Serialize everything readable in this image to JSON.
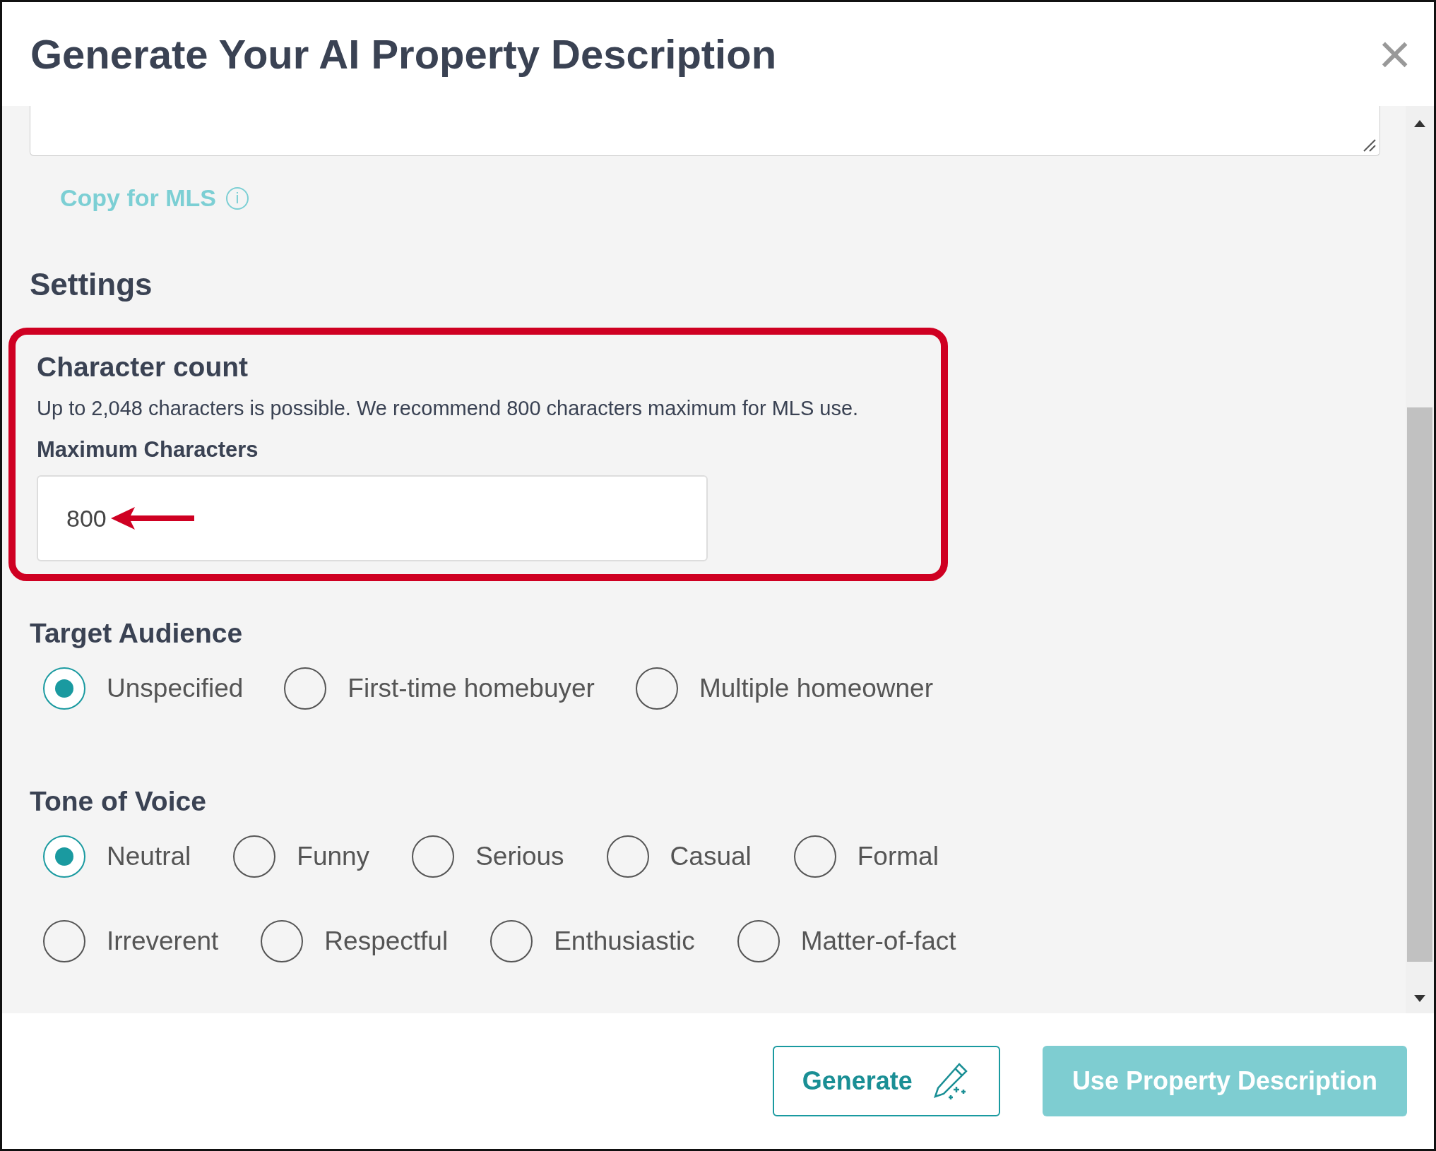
{
  "dialog": {
    "title": "Generate Your AI Property Description",
    "close": "×"
  },
  "copy_link": {
    "label": "Copy for MLS",
    "info": "i"
  },
  "settings": {
    "title": "Settings",
    "character_count": {
      "title": "Character count",
      "highlighted": true,
      "description": "Up to 2,048 characters is possible. We recommend 800 characters maximum for MLS use.",
      "field_label": "Maximum Characters",
      "value": "800"
    },
    "target_audience": {
      "title": "Target Audience",
      "options": [
        {
          "label": "Unspecified",
          "selected": true
        },
        {
          "label": "First-time homebuyer",
          "selected": false
        },
        {
          "label": "Multiple homeowner",
          "selected": false
        }
      ]
    },
    "tone_of_voice": {
      "title": "Tone of Voice",
      "options": [
        {
          "label": "Neutral",
          "selected": true
        },
        {
          "label": "Funny",
          "selected": false
        },
        {
          "label": "Serious",
          "selected": false
        },
        {
          "label": "Casual",
          "selected": false
        },
        {
          "label": "Formal",
          "selected": false
        },
        {
          "label": "Irreverent",
          "selected": false
        },
        {
          "label": "Respectful",
          "selected": false
        },
        {
          "label": "Enthusiastic",
          "selected": false
        },
        {
          "label": "Matter-of-fact",
          "selected": false
        }
      ]
    }
  },
  "buttons": [
    {
      "label": "Generate",
      "kind": "outline"
    },
    {
      "label": "Use Property Description",
      "kind": "filled"
    }
  ]
}
